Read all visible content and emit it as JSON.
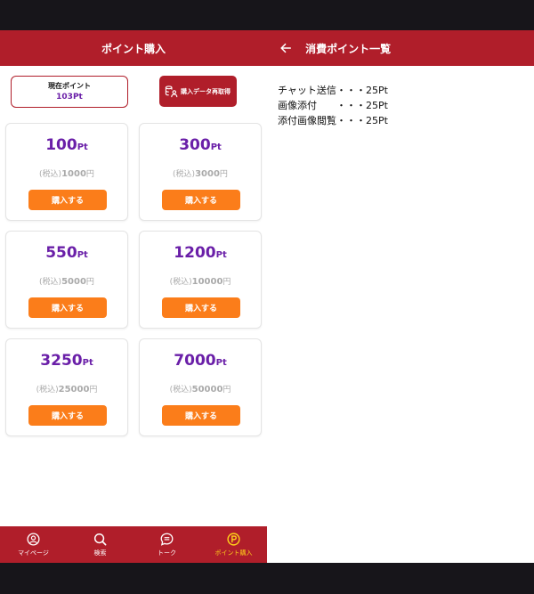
{
  "colors": {
    "brand_red": "#b01e2a",
    "accent_orange": "#fb7d1a",
    "point_purple": "#6a1fa8",
    "active_nav": "#ffd21a"
  },
  "left": {
    "title": "ポイント購入",
    "current_points_label": "現在ポイント",
    "current_points_value": "103Pt",
    "refetch_label": "購入データ再取得",
    "packages": [
      {
        "amount": "100",
        "unit": "Pt",
        "tax_label": "(税込)",
        "price": "1000",
        "yen": "円",
        "buy_label": "購入する"
      },
      {
        "amount": "300",
        "unit": "Pt",
        "tax_label": "(税込)",
        "price": "3000",
        "yen": "円",
        "buy_label": "購入する"
      },
      {
        "amount": "550",
        "unit": "Pt",
        "tax_label": "(税込)",
        "price": "5000",
        "yen": "円",
        "buy_label": "購入する"
      },
      {
        "amount": "1200",
        "unit": "Pt",
        "tax_label": "(税込)",
        "price": "10000",
        "yen": "円",
        "buy_label": "購入する"
      },
      {
        "amount": "3250",
        "unit": "Pt",
        "tax_label": "(税込)",
        "price": "25000",
        "yen": "円",
        "buy_label": "購入する"
      },
      {
        "amount": "7000",
        "unit": "Pt",
        "tax_label": "(税込)",
        "price": "50000",
        "yen": "円",
        "buy_label": "購入する"
      }
    ],
    "nav": [
      {
        "label": "マイページ",
        "icon": "person-icon",
        "active": false
      },
      {
        "label": "検索",
        "icon": "search-icon",
        "active": false
      },
      {
        "label": "トーク",
        "icon": "chat-icon",
        "active": false
      },
      {
        "label": "ポイント購入",
        "icon": "points-icon",
        "active": true
      }
    ]
  },
  "right": {
    "title": "消費ポイント一覧",
    "items": [
      {
        "name": "チャット送信",
        "dots": "・・・",
        "cost": "25Pt"
      },
      {
        "name": "画像添付",
        "dots": "・・・",
        "cost": "25Pt"
      },
      {
        "name": "添付画像閲覧",
        "dots": "・・・",
        "cost": "25Pt"
      }
    ]
  }
}
